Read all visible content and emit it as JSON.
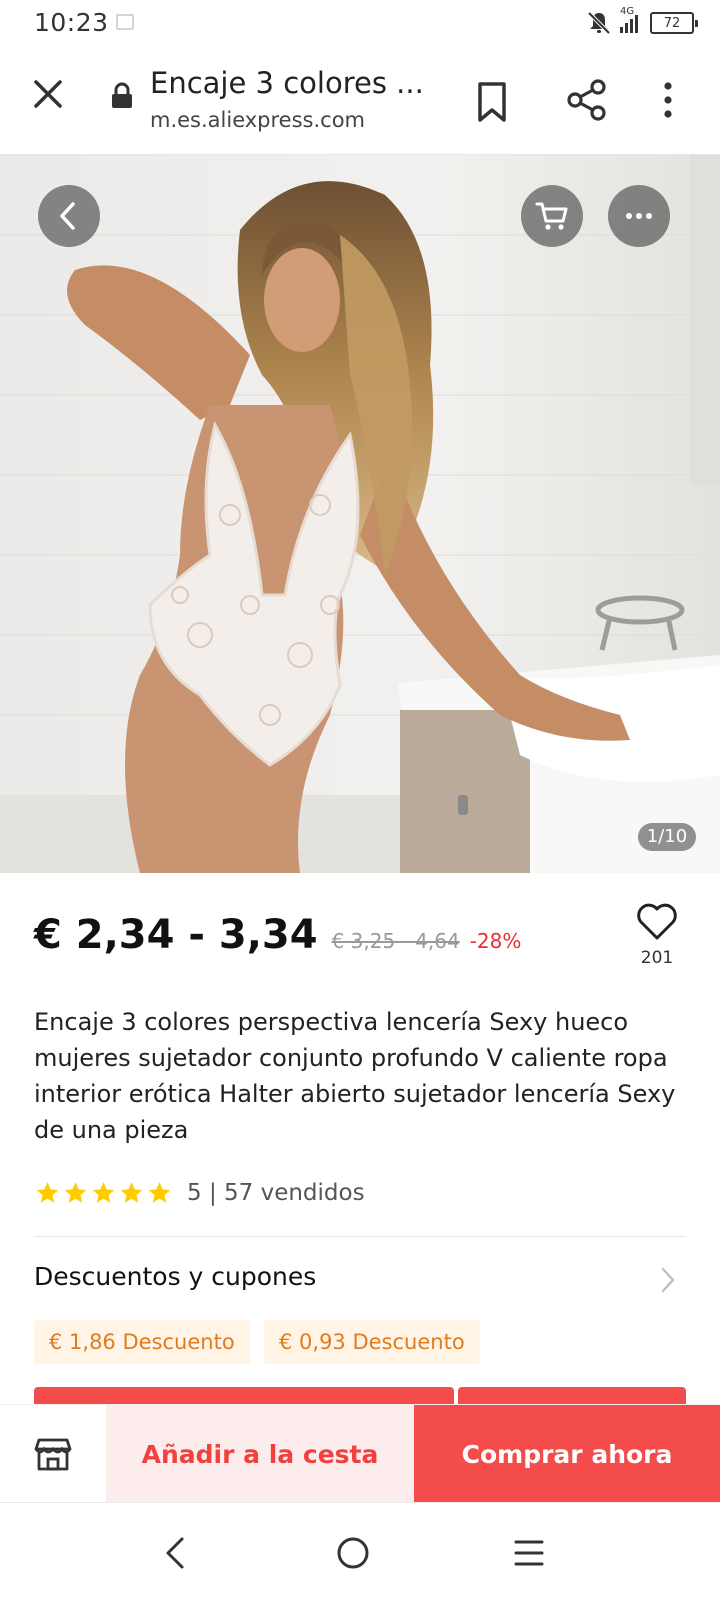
{
  "status_bar": {
    "time": "10:23",
    "network": "4G",
    "battery": "72",
    "icons": [
      "image-icon",
      "mute-icon",
      "signal-icon",
      "battery-icon"
    ]
  },
  "browser": {
    "title": "Encaje 3 colores ...",
    "url": "m.es.aliexpress.com",
    "icons": [
      "close-icon",
      "lock-icon",
      "bookmark-icon",
      "share-icon",
      "more-vertical-icon"
    ]
  },
  "gallery": {
    "counter": "1/10",
    "icons": [
      "back-icon",
      "cart-icon",
      "more-horizontal-icon"
    ]
  },
  "product": {
    "price": "€ 2,34 - 3,34",
    "original_price": "€ 3,25 - 4,64",
    "discount": "-28%",
    "wishlist_count": "201",
    "title": "Encaje 3 colores perspectiva lencería Sexy hueco mujeres sujetador conjunto profundo V caliente ropa interior erótica Halter abierto sujetador lencería Sexy de una pieza",
    "rating_value": 5,
    "rating_text": "5 | 57 vendidos"
  },
  "coupons": {
    "title": "Descuentos y cupones",
    "items": [
      "€ 1,86 Descuento",
      "€ 0,93 Descuento"
    ]
  },
  "actions": {
    "add_to_cart": "Añadir a la cesta",
    "buy_now": "Comprar ahora"
  },
  "colors": {
    "accent_red": "#f44b4b",
    "discount_red": "#e62e35",
    "coupon_orange": "#e07c1e",
    "coupon_bg": "#fff4e6",
    "star_yellow": "#ffcc00"
  }
}
